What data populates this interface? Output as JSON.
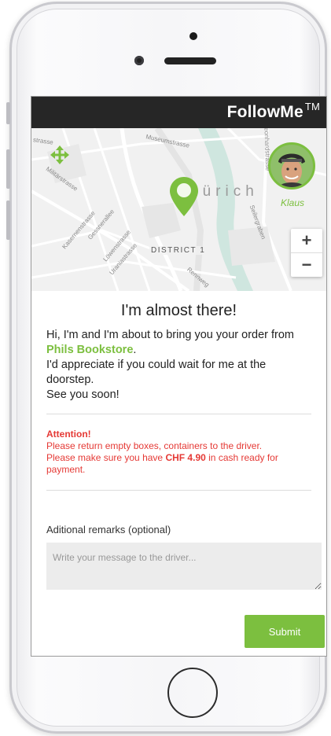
{
  "app": {
    "brand": "FollowMe",
    "trademark": "TM"
  },
  "map": {
    "city": "Zürich",
    "district": "DISTRICT 1",
    "streets": [
      "Museumstrasse",
      "Militärstrasse",
      "Kasernenstrasse",
      "Gessnerallee",
      "Löwenstrasse",
      "Uraniastrasse",
      "Rennweg",
      "Seilergraben",
      "Leonhardstrasse",
      "strasse"
    ],
    "driver_name": "Klaus",
    "zoom_in": "+",
    "zoom_out": "−"
  },
  "message": {
    "headline": "I'm almost there!",
    "line1": "Hi, I'm and I'm about to bring you your order from",
    "store": "Phils Bookstore",
    "store_suffix": ".",
    "line2": "I'd appreciate if you could wait for me at the doorstep.",
    "line3": "See you soon!"
  },
  "attention": {
    "title": "Attention!",
    "line1": "Please return empty boxes, containers to the driver.",
    "line2_prefix": "Please make sure you have",
    "amount": "CHF 4.90",
    "line2_suffix": "in cash ready for payment."
  },
  "remarks": {
    "label": "Aditional remarks (optional)",
    "placeholder": "Write your message to the driver...",
    "value": ""
  },
  "submit_label": "Submit",
  "colors": {
    "accent": "#7cbf3f",
    "header_bg": "#262626",
    "warning": "#e53935"
  }
}
